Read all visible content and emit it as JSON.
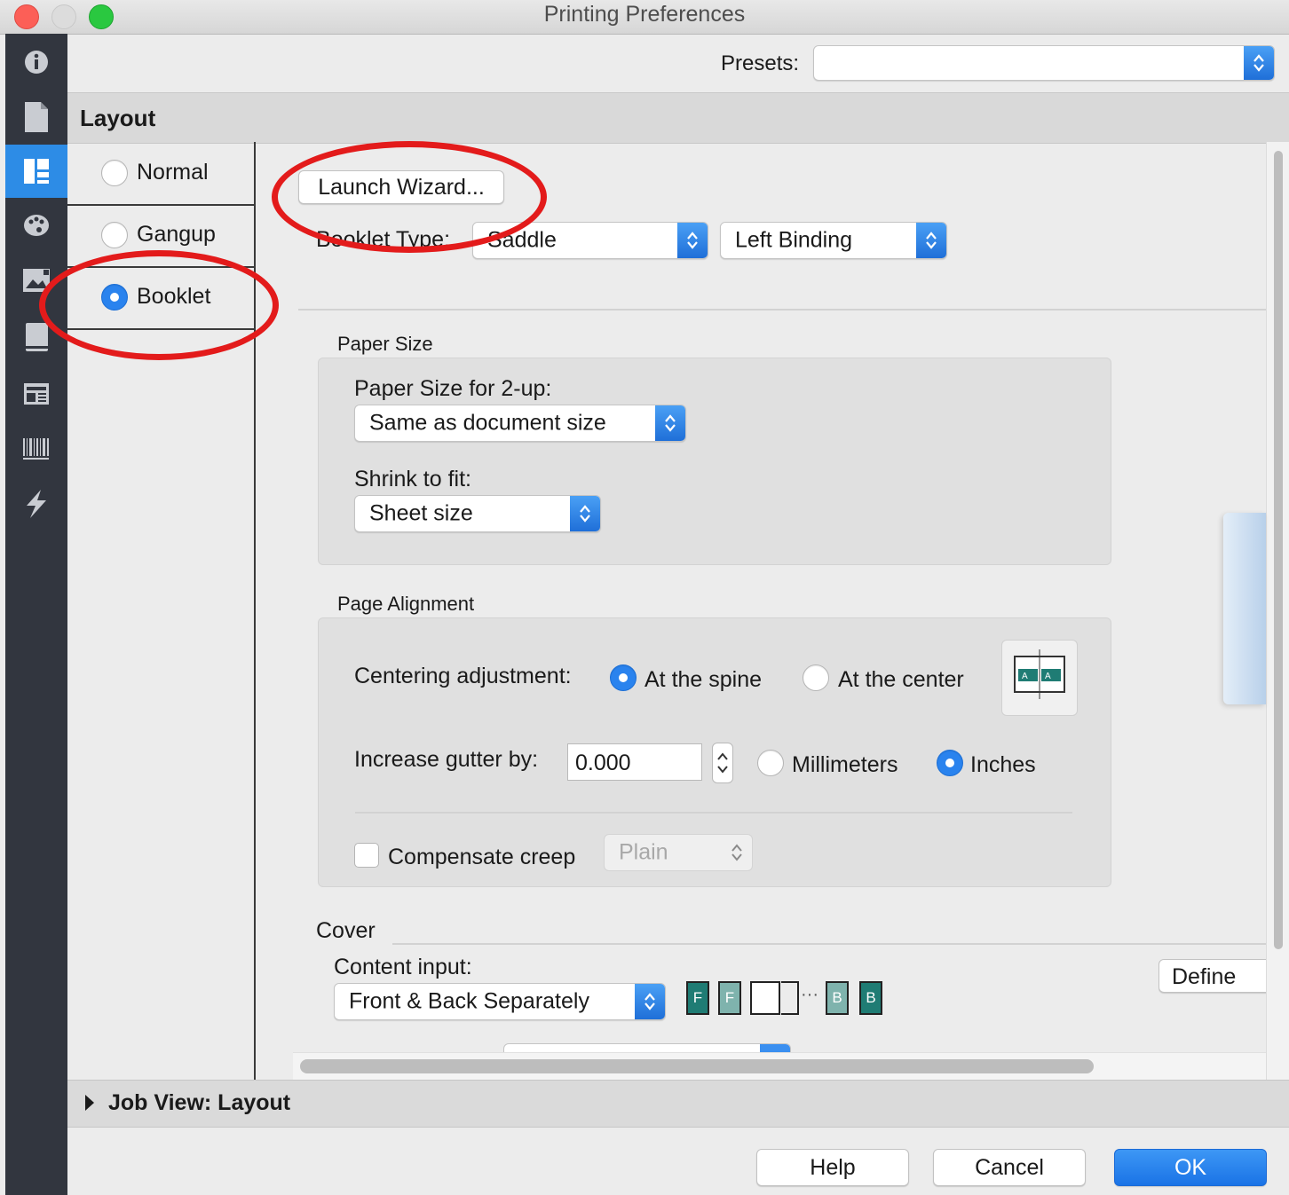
{
  "window": {
    "title": "Printing Preferences"
  },
  "sidebar": {
    "icons": [
      "info-icon",
      "document-icon",
      "layout-icon",
      "palette-icon",
      "image-icon",
      "book-icon",
      "newspaper-icon",
      "barcode-icon",
      "lightning-icon"
    ]
  },
  "presets": {
    "label": "Presets:",
    "value": ""
  },
  "section_title": "Layout",
  "layout_options": [
    {
      "label": "Normal",
      "selected": false
    },
    {
      "label": "Gangup",
      "selected": false
    },
    {
      "label": "Booklet",
      "selected": true
    }
  ],
  "launch_wizard": "Launch Wizard...",
  "booklet_type": {
    "label": "Booklet Type:",
    "type": "Saddle",
    "binding": "Left Binding"
  },
  "paper_size": {
    "title": "Paper Size",
    "two_up_label": "Paper Size for 2-up:",
    "two_up_value": "Same as document size",
    "shrink_label": "Shrink to fit:",
    "shrink_value": "Sheet size"
  },
  "page_alignment": {
    "title": "Page Alignment",
    "centering_label": "Centering adjustment:",
    "at_spine": "At the spine",
    "at_center": "At the center",
    "gutter_label": "Increase gutter by:",
    "gutter_value": "0.000",
    "millimeters": "Millimeters",
    "inches": "Inches",
    "creep_label": "Compensate creep",
    "creep_value": "Plain"
  },
  "cover": {
    "title": "Cover",
    "content_label": "Content input:",
    "content_value": "Front & Back Separately",
    "define_button": "Define Cover...",
    "pages": [
      "F",
      "F",
      "B",
      "B"
    ]
  },
  "job_view": "Job View: Layout",
  "buttons": {
    "help": "Help",
    "cancel": "Cancel",
    "ok": "OK"
  },
  "colors": {
    "accent": "#2a83ee",
    "annotation": "#e31b1b"
  }
}
